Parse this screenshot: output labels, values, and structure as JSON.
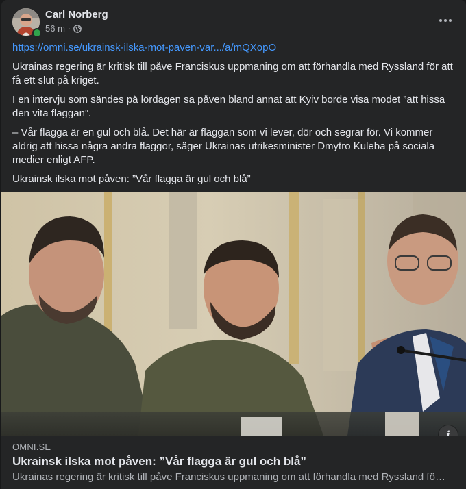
{
  "post": {
    "author": "Carl Norberg",
    "time": "56 m",
    "separator": "·",
    "link_text": "https://omni.se/ukrainsk-ilska-mot-paven-var.../a/mQXopO",
    "paragraphs": [
      "Ukrainas regering är kritisk till påve Franciskus uppmaning om att förhandla med Ryssland för att få ett slut på kriget.",
      "I en intervju som sändes på lördagen sa påven bland annat att Kyiv borde visa modet ”att hissa den vita flaggan”.",
      "– Vår flagga är en gul och blå. Det här är flaggan som vi lever, dör och segrar för. Vi kommer aldrig att hissa några andra flaggor, säger Ukrainas utrikesminister Dmytro Kuleba på sociala medier enligt AFP.",
      "Ukrainsk ilska mot påven: ”Vår flagga är gul och blå”"
    ],
    "icons": {
      "privacy": "globe-icon",
      "menu": "more-options-icon",
      "info": "info-icon"
    }
  },
  "link_preview": {
    "domain": "OMNI.SE",
    "title": "Ukrainsk ilska mot påven: ”Vår flagga är gul och blå”",
    "description": "Ukrainas regering är kritisk till påve Franciskus uppmaning om att förhandla med Ryssland för att få ett slut på kriget.",
    "info_label": "i"
  },
  "colors": {
    "background": "#18191a",
    "card": "#242526",
    "link": "#4599ff",
    "online": "#31a24c"
  }
}
